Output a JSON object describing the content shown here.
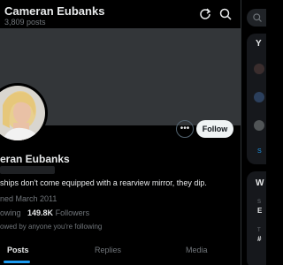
{
  "header": {
    "title": "Cameran Eubanks",
    "post_count": "3,809 posts"
  },
  "profile": {
    "name": "eran Eubanks",
    "bio": "ships don't come equipped with a rearview mirror, they dip.",
    "joined": "ned March 2011",
    "following_label": "owing",
    "followers_count": "149.8K",
    "followers_label": "Followers",
    "followed_by": "owed by anyone you're following"
  },
  "actions": {
    "follow_label": "Follow",
    "more_label": "•••"
  },
  "tabs": [
    {
      "label": "Posts"
    },
    {
      "label": "Replies"
    },
    {
      "label": "Media"
    }
  ],
  "sidebar": {
    "letter_y": "Y",
    "letter_w": "W",
    "s_text": "S",
    "e_text": "E",
    "t_text": "T",
    "hash_text": "#",
    "small1": "S",
    "small2": "E"
  },
  "colors": {
    "accent": "#1d9bf0",
    "banner": "#333639",
    "background": "#000000"
  }
}
